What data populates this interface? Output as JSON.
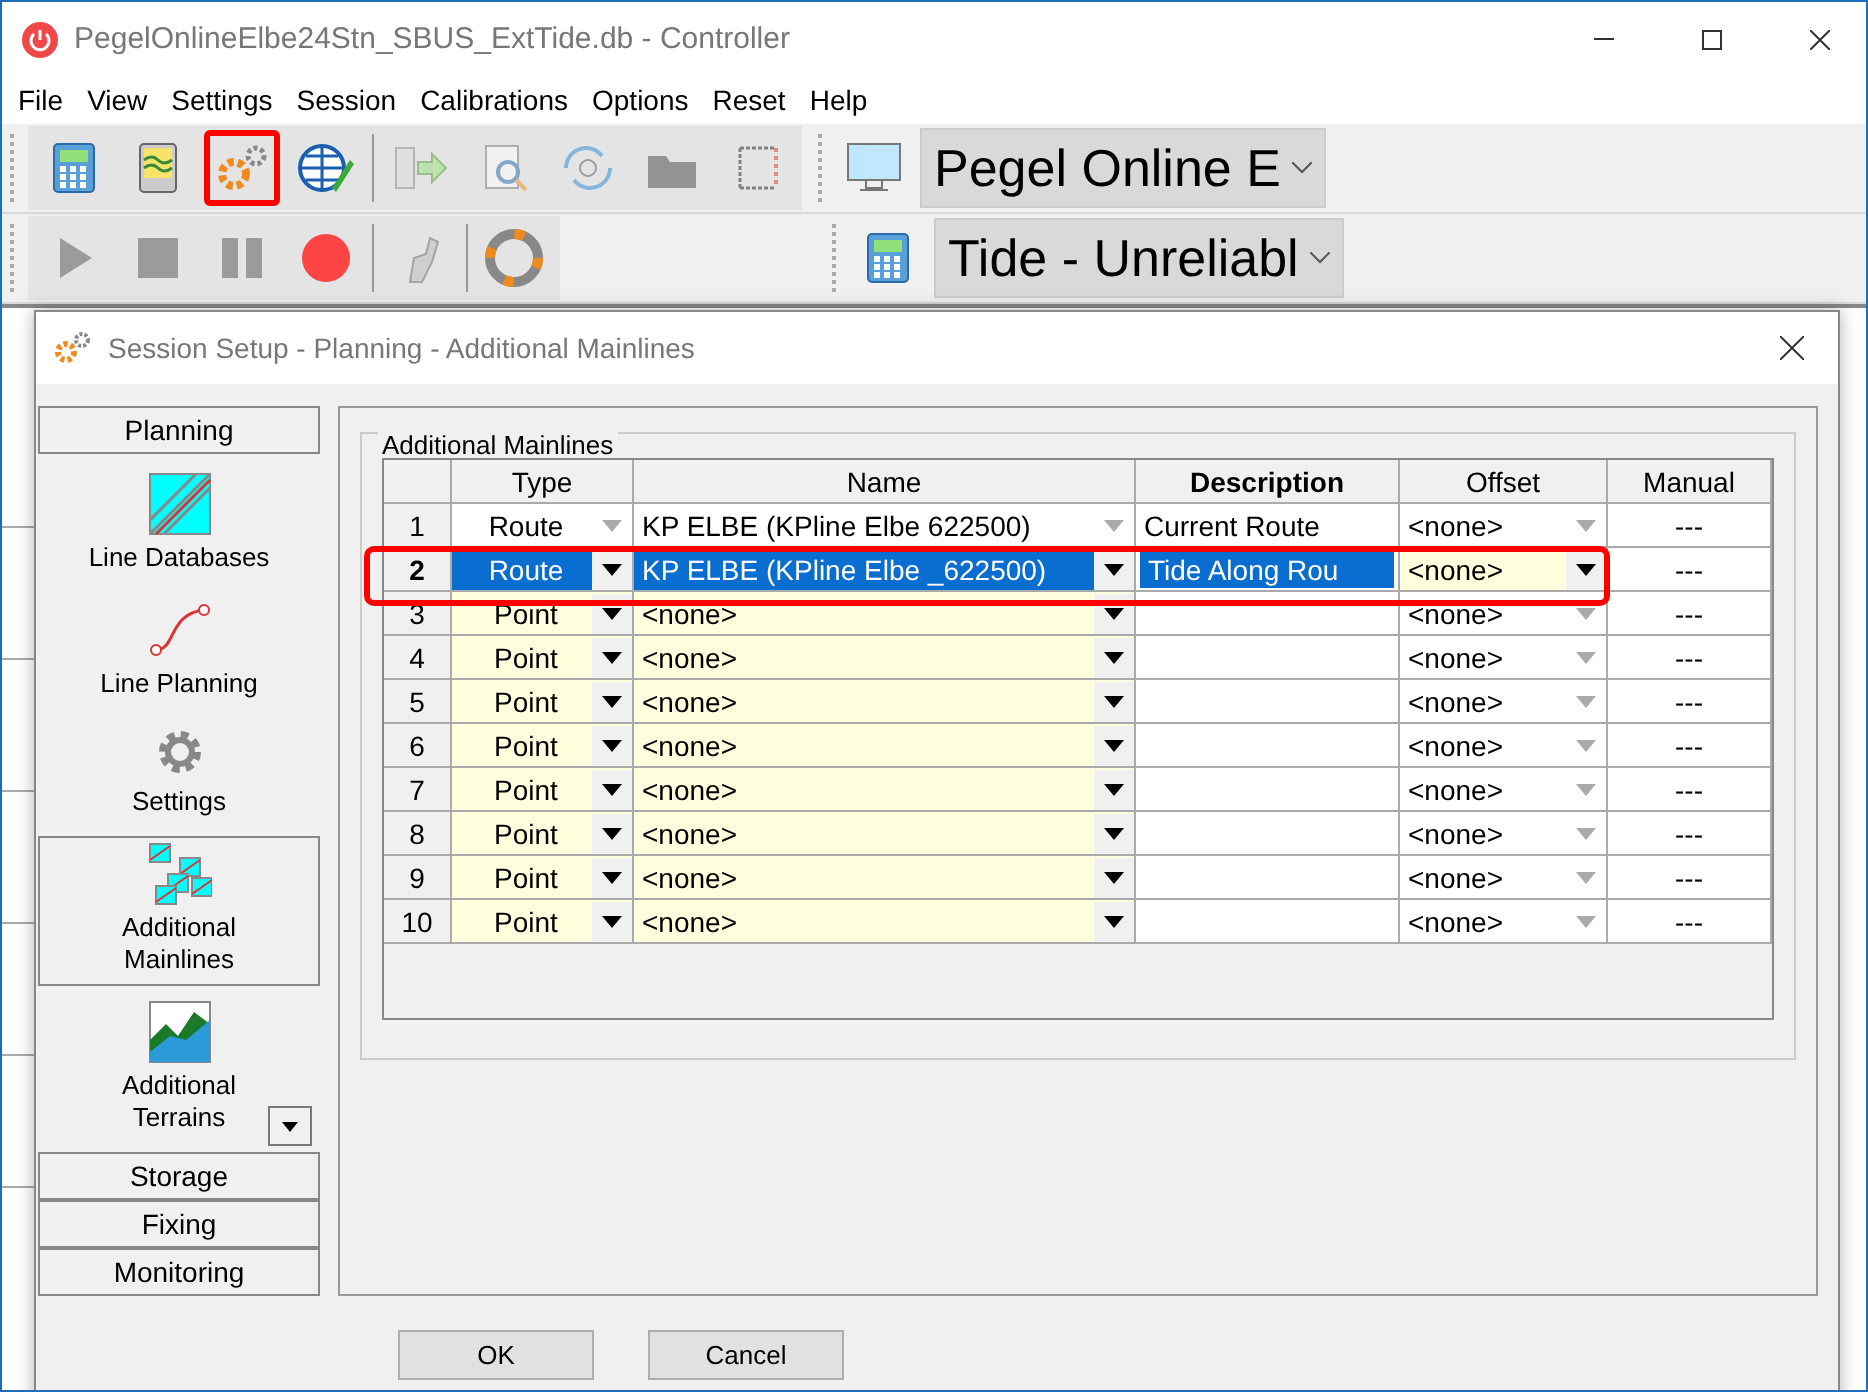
{
  "window": {
    "title": "PegelOnlineElbe24Stn_SBUS_ExtTide.db - Controller"
  },
  "menu": [
    "File",
    "View",
    "Settings",
    "Session",
    "Calibrations",
    "Options",
    "Reset",
    "Help"
  ],
  "toolbar_1": {
    "buttons": [
      {
        "disabled": false,
        "annotated": false
      },
      {
        "disabled": false,
        "annotated": false
      },
      {
        "disabled": false,
        "annotated": true
      },
      {
        "disabled": false,
        "annotated": false
      },
      {
        "disabled": true,
        "annotated": false
      },
      {
        "disabled": true,
        "annotated": false
      },
      {
        "disabled": true,
        "annotated": false
      },
      {
        "disabled": true,
        "annotated": false
      },
      {
        "disabled": true,
        "annotated": false
      }
    ],
    "combo": "Pegel Online E"
  },
  "toolbar_2": {
    "buttons": [
      {
        "disabled": true,
        "annotated": false
      },
      {
        "disabled": true,
        "annotated": false
      },
      {
        "disabled": true,
        "annotated": false
      },
      {
        "disabled": false,
        "annotated": false
      },
      {
        "disabled": true,
        "annotated": false
      },
      {
        "disabled": false,
        "annotated": false
      }
    ],
    "combo": "Tide - Unreliabl"
  },
  "dialog": {
    "title": "Session Setup - Planning -  Additional Mainlines",
    "nav": {
      "sections_top": [
        {
          "label": "Planning",
          "expanded": true
        }
      ],
      "items": [
        {
          "label": "Line Databases",
          "selected": false
        },
        {
          "label": "Line Planning",
          "selected": false
        },
        {
          "label": "Settings",
          "selected": false
        },
        {
          "label": "Additional Mainlines",
          "selected": true
        },
        {
          "label": "Additional Terrains",
          "selected": false
        }
      ],
      "sections_bottom": [
        {
          "label": "Storage",
          "expanded": false
        },
        {
          "label": "Fixing",
          "expanded": false
        },
        {
          "label": "Monitoring",
          "expanded": false
        }
      ]
    },
    "group_title": "Additional Mainlines",
    "table": {
      "columns": [
        {
          "label": "Type",
          "bold": false
        },
        {
          "label": "Name",
          "bold": false
        },
        {
          "label": "Description",
          "bold": true
        },
        {
          "label": "Offset",
          "bold": false
        },
        {
          "label": "Manual",
          "bold": false
        }
      ],
      "rows": [
        {
          "index": "1",
          "type": "Route",
          "name": "KP ELBE (KPline Elbe  622500)",
          "description": "Current Route",
          "offset": "<none>",
          "manual": "---",
          "selected": false,
          "editable": false,
          "offset_editable": false,
          "annotated": false
        },
        {
          "index": "2",
          "type": "Route",
          "name": "KP ELBE (KPline Elbe _622500)",
          "description": "Tide Along Rou",
          "offset": "<none>",
          "manual": "---",
          "selected": true,
          "editable": true,
          "offset_editable": true,
          "annotated": true
        },
        {
          "index": "3",
          "type": "Point",
          "name": "<none>",
          "description": "",
          "offset": "<none>",
          "manual": "---",
          "selected": false,
          "editable": true,
          "offset_editable": false,
          "annotated": false
        },
        {
          "index": "4",
          "type": "Point",
          "name": "<none>",
          "description": "",
          "offset": "<none>",
          "manual": "---",
          "selected": false,
          "editable": true,
          "offset_editable": false,
          "annotated": false
        },
        {
          "index": "5",
          "type": "Point",
          "name": "<none>",
          "description": "",
          "offset": "<none>",
          "manual": "---",
          "selected": false,
          "editable": true,
          "offset_editable": false,
          "annotated": false
        },
        {
          "index": "6",
          "type": "Point",
          "name": "<none>",
          "description": "",
          "offset": "<none>",
          "manual": "---",
          "selected": false,
          "editable": true,
          "offset_editable": false,
          "annotated": false
        },
        {
          "index": "7",
          "type": "Point",
          "name": "<none>",
          "description": "",
          "offset": "<none>",
          "manual": "---",
          "selected": false,
          "editable": true,
          "offset_editable": false,
          "annotated": false
        },
        {
          "index": "8",
          "type": "Point",
          "name": "<none>",
          "description": "",
          "offset": "<none>",
          "manual": "---",
          "selected": false,
          "editable": true,
          "offset_editable": false,
          "annotated": false
        },
        {
          "index": "9",
          "type": "Point",
          "name": "<none>",
          "description": "",
          "offset": "<none>",
          "manual": "---",
          "selected": false,
          "editable": true,
          "offset_editable": false,
          "annotated": false
        },
        {
          "index": "10",
          "type": "Point",
          "name": "<none>",
          "description": "",
          "offset": "<none>",
          "manual": "---",
          "selected": false,
          "editable": true,
          "offset_editable": false,
          "annotated": false
        }
      ]
    },
    "buttons": [
      "OK",
      "Cancel"
    ]
  }
}
